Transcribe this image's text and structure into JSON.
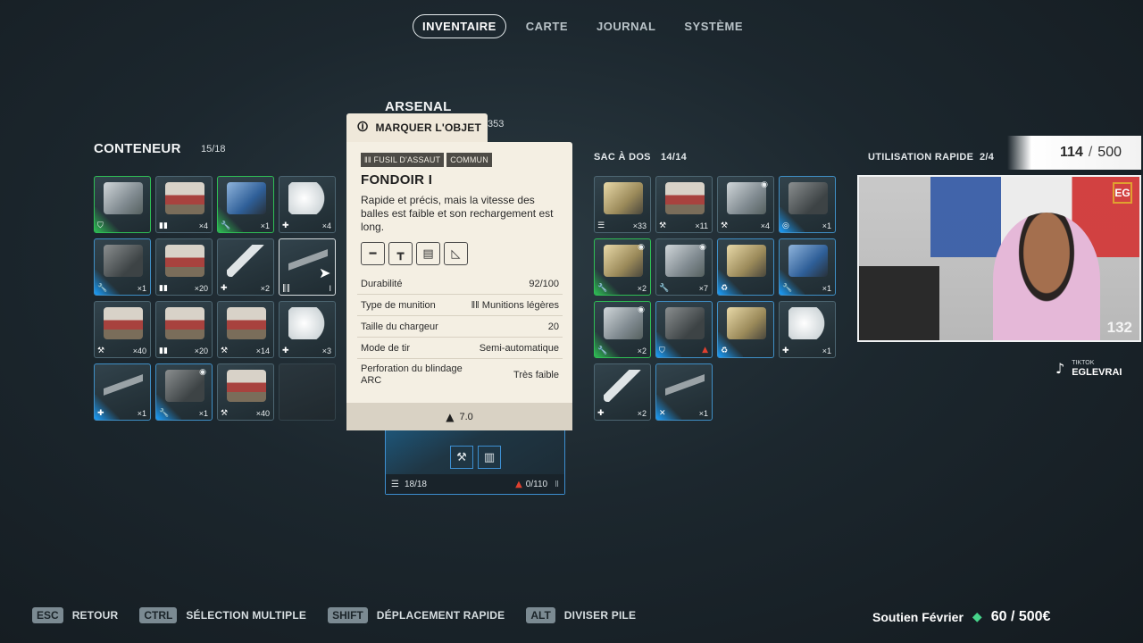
{
  "nav": {
    "tabs": [
      {
        "label": "INVENTAIRE",
        "active": true
      },
      {
        "label": "CARTE",
        "active": false
      },
      {
        "label": "JOURNAL",
        "active": false
      },
      {
        "label": "SYSTÈME",
        "active": false
      }
    ]
  },
  "container": {
    "title": "CONTENEUR",
    "count": "15/18",
    "slots": [
      {
        "icon": "shield-icon",
        "qty": ""
      },
      {
        "icon": "ammo-icon",
        "qty": "×4"
      },
      {
        "icon": "wrench-icon",
        "qty": "×1"
      },
      {
        "icon": "plus-icon",
        "qty": "×4"
      },
      {
        "icon": "wrench-icon",
        "qty": "×1"
      },
      {
        "icon": "ammo-icon",
        "qty": "×20"
      },
      {
        "icon": "plus-icon",
        "qty": "×2"
      },
      {
        "icon": "bullets-icon",
        "qty": "I"
      },
      {
        "icon": "hammer-icon",
        "qty": "×40"
      },
      {
        "icon": "ammo-icon",
        "qty": "×20"
      },
      {
        "icon": "hammer-icon",
        "qty": "×14"
      },
      {
        "icon": "plus-icon",
        "qty": "×3"
      },
      {
        "icon": "plus-icon",
        "qty": "×1"
      },
      {
        "icon": "wrench-icon",
        "qty": "×1"
      },
      {
        "icon": "hammer-icon",
        "qty": "×40"
      },
      {
        "icon": "",
        "qty": ""
      }
    ]
  },
  "arsenal": {
    "title": "ARSENAL",
    "value": "353",
    "footer_count": "18/18",
    "footer_warning": "0/110"
  },
  "tooltip": {
    "mark_label": "MARQUER L'OBJET",
    "tag_type": "FUSIL D'ASSAUT",
    "tag_rarity": "COMMUN",
    "name": "FONDOIR I",
    "description": "Rapide et précis, mais la vitesse des balles est faible et son rechargement est long.",
    "stats": [
      {
        "label": "Durabilité",
        "value": "92/100"
      },
      {
        "label": "Type de munition",
        "value": "Munitions légères"
      },
      {
        "label": "Taille du chargeur",
        "value": "20"
      },
      {
        "label": "Mode de tir",
        "value": "Semi-automatique"
      },
      {
        "label": "Perforation du blindage ARC",
        "value": "Très faible"
      }
    ],
    "weight": "7.0"
  },
  "backpack": {
    "title": "SAC À DOS",
    "count": "14/14",
    "slots": [
      {
        "icon": "list-icon",
        "qty": "×33"
      },
      {
        "icon": "hammer-icon",
        "qty": "×11"
      },
      {
        "icon": "hammer-icon",
        "qty": "×4"
      },
      {
        "icon": "target-icon",
        "qty": "×1"
      },
      {
        "icon": "wrench-icon",
        "qty": "×2"
      },
      {
        "icon": "wrench-icon",
        "qty": "×7"
      },
      {
        "icon": "recycle-icon",
        "qty": ""
      },
      {
        "icon": "wrench-icon",
        "qty": "×1"
      },
      {
        "icon": "wrench-icon",
        "qty": "×2"
      },
      {
        "icon": "shield-icon",
        "qty": ""
      },
      {
        "icon": "recycle-icon",
        "qty": ""
      },
      {
        "icon": "plus-icon",
        "qty": "×1"
      },
      {
        "icon": "plus-icon",
        "qty": "×2"
      },
      {
        "icon": "cross-icon",
        "qty": "×1"
      }
    ]
  },
  "quick_use": {
    "title": "UTILISATION RAPIDE",
    "count": "2/4"
  },
  "overlay": {
    "goal_current": "114",
    "goal_max": "500",
    "viewer_count": "132",
    "tiktok_label": "TIKTOK",
    "tiktok_handle": "EGLEVRAI",
    "donation_label": "Soutien Février",
    "donation_value": "60 / 500€"
  },
  "bottom_hints": [
    {
      "key": "ESC",
      "label": "RETOUR"
    },
    {
      "key": "CTRL",
      "label": "SÉLECTION MULTIPLE"
    },
    {
      "key": "SHIFT",
      "label": "DÉPLACEMENT RAPIDE"
    },
    {
      "key": "ALT",
      "label": "DIVISER PILE"
    }
  ]
}
